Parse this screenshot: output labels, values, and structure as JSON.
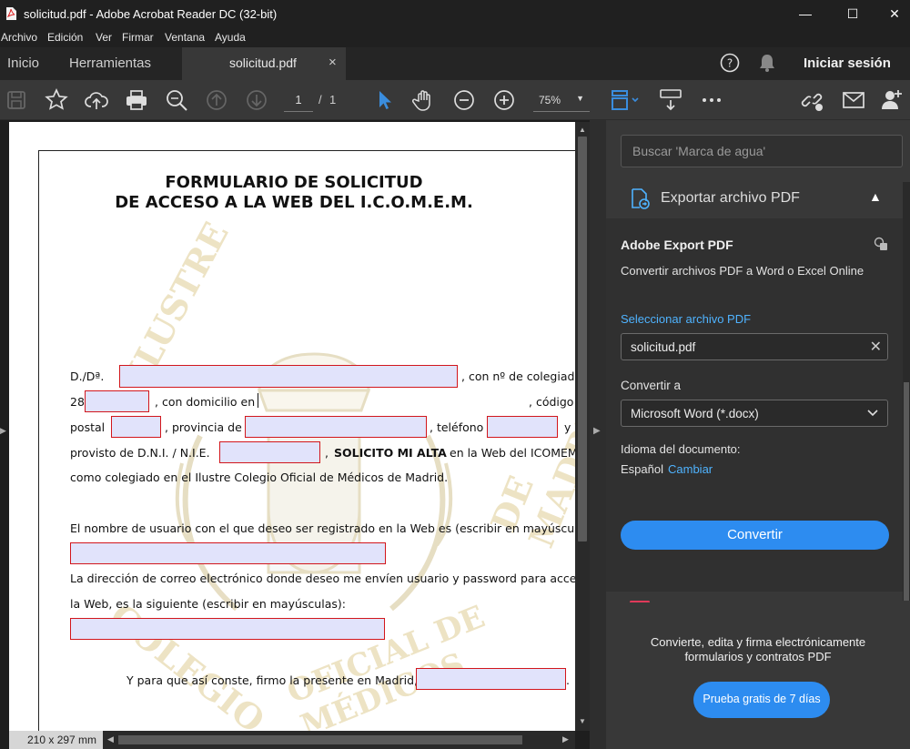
{
  "window": {
    "title": "solicitud.pdf - Adobe Acrobat Reader DC (32-bit)",
    "minimize": "—",
    "maximize": "☐",
    "close": "✕"
  },
  "menu": [
    "Archivo",
    "Edición",
    "Ver",
    "Firmar",
    "Ventana",
    "Ayuda"
  ],
  "tabs": {
    "home": "Inicio",
    "tools": "Herramientas",
    "document": "solicitud.pdf",
    "close": "×",
    "signin": "Iniciar sesión"
  },
  "toolbar": {
    "page_current": "1",
    "page_sep": "/",
    "page_total": "1",
    "zoom": "75%"
  },
  "document": {
    "title_line1": "FORMULARIO DE SOLICITUD",
    "title_line2": "DE ACCESO A LA WEB DEL I.C.O.M.E.M.",
    "l1_a": "D./Dª.",
    "l1_b": ", con nº de colegiado",
    "l2_a": "28",
    "l2_b": ", con domicilio en",
    "l2_c": ", código",
    "l3_a": "postal",
    "l3_b": ", provincia de",
    "l3_c": ", teléfono",
    "l3_d": "y",
    "l4_a": "provisto de D.N.I. / N.I.E.",
    "l4_b": ",",
    "l4_bold": "SOLICITO MI ALTA",
    "l4_c": "en la Web del ICOMEM",
    "l5": "como colegiado en el Ilustre Colegio Oficial de Médicos de Madrid.",
    "l6": "El nombre de usuario con el que deseo ser registrado en la Web es (escribir en mayúsculas):",
    "l7": "La dirección de correo electrónico donde deseo me envíen usuario y password para acceder a",
    "l8": "la Web, es la siguiente (escribir en mayúsculas):",
    "l9": "Y para que así conste, firmo la presente en Madrid, a",
    "l9_end": ".",
    "watermark_top": "ILUSTRE",
    "watermark_right": "DE MADRID",
    "watermark_bottom": "OFICIAL DE MÉDICOS",
    "watermark_left": "COLEGIO",
    "page_size": "210 x 297 mm"
  },
  "right_pane": {
    "search_placeholder": "Buscar 'Marca de agua'",
    "export_header": "Exportar archivo PDF",
    "product": "Adobe Export PDF",
    "subtitle": "Convertir archivos PDF a Word o Excel Online",
    "select_file_link": "Seleccionar archivo PDF",
    "file_name": "solicitud.pdf",
    "convert_to_label": "Convertir a",
    "format_value": "Microsoft Word (*.docx)",
    "language_label": "Idioma del documento:",
    "language_value": "Español",
    "change_link": "Cambiar",
    "convert_button": "Convertir",
    "promo_line1": "Convierte, edita y firma electrónicamente",
    "promo_line2": "formularios y contratos PDF",
    "trial_button": "Prueba gratis de 7 días"
  },
  "colors": {
    "accent": "#2d8cf0",
    "link": "#4fb3ff",
    "field_fill": "#e1e3fb",
    "field_border": "#d2161c"
  }
}
